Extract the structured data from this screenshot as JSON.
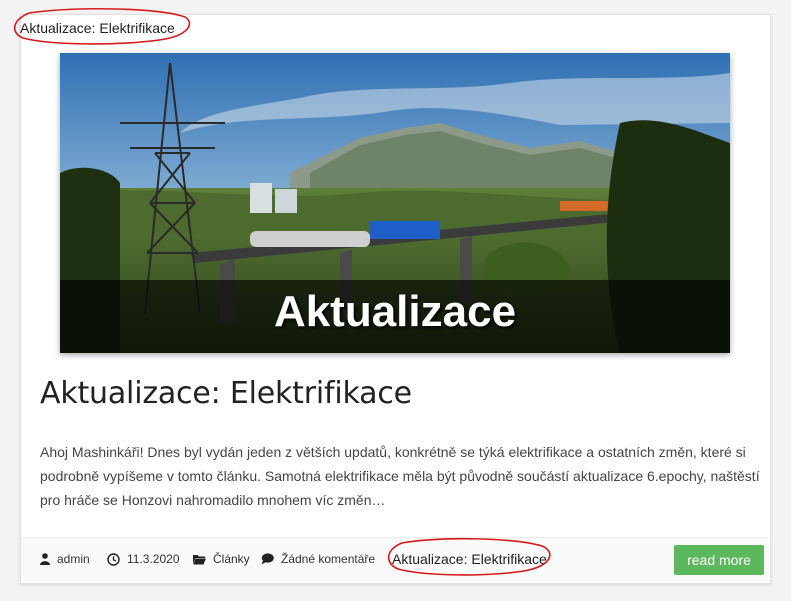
{
  "post": {
    "top_label": "Aktualizace: Elektrifikace",
    "image_caption": "Aktualizace",
    "title": "Aktualizace: Elektrifikace",
    "excerpt": "Ahoj Mashinkáři! Dnes byl vydán jeden z větších updatů, konkrétně se týká elektrifikace a ostatních změn, které si podrobně vypíšeme v tomto článku. Samotná elektrifikace měla být původně součástí aktualizace 6.epochy, naštěstí pro hráče se Honzovi nahromadilo mnohem víc změn…",
    "meta": {
      "author": "admin",
      "date": "11.3.2020",
      "category": "Články",
      "comments": "Žádné komentáře",
      "tag": "Aktualizace: Elektrifikace"
    },
    "read_more_label": "read more"
  },
  "colors": {
    "button": "#5cb85c",
    "annotation": "#d41a1a"
  },
  "icons": [
    "user-icon",
    "clock-icon",
    "folder-icon",
    "comment-icon"
  ]
}
